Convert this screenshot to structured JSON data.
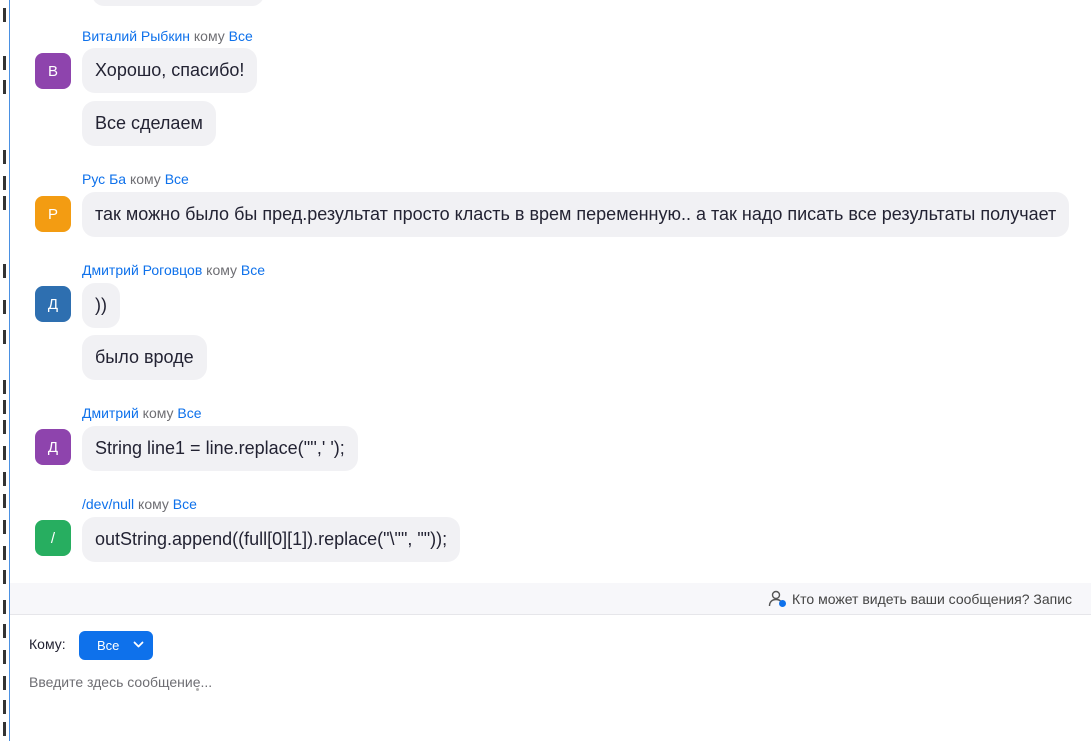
{
  "chat": {
    "recipient_prefix": "кому",
    "messages": [
      {
        "sender": "Виталий Рыбкин",
        "recipient": "Все",
        "avatar_letter": "В",
        "avatar_color": "#8e44ad",
        "bubbles": [
          "Хорошо, спасибо!",
          "Все сделаем"
        ]
      },
      {
        "sender": "Рус Ба",
        "recipient": "Все",
        "avatar_letter": "Р",
        "avatar_color": "#f39c12",
        "bubbles": [
          "так можно было бы пред.результат просто класть в врем переменную.. а так надо писать все результаты получает"
        ]
      },
      {
        "sender": "Дмитрий Роговцов",
        "recipient": "Все",
        "avatar_letter": "Д",
        "avatar_color": "#2e6fb0",
        "bubbles": [
          "))",
          "было вроде"
        ]
      },
      {
        "sender": "Дмитрий",
        "recipient": "Все",
        "avatar_letter": "Д",
        "avatar_color": "#8e44ad",
        "bubbles": [
          "String line1 = line.replace('\"',' ');"
        ]
      },
      {
        "sender": "/dev/null",
        "recipient": "Все",
        "avatar_letter": "/",
        "avatar_color": "#27ae60",
        "bubbles": [
          "outString.append((full[0][1]).replace(\"\\\"\", \"\"));"
        ]
      }
    ]
  },
  "footer": {
    "visibility_note": "Кто может видеть ваши сообщения? Запис"
  },
  "composer": {
    "to_label": "Кому:",
    "to_value": "Все",
    "input_placeholder": "Введите здесь сообщение..."
  },
  "colors": {
    "accent": "#0e71eb",
    "bubble_bg": "#f1f1f4"
  },
  "icons": {
    "avatar_privacy": "person-privacy-icon",
    "dropdown": "chevron-down-icon"
  }
}
